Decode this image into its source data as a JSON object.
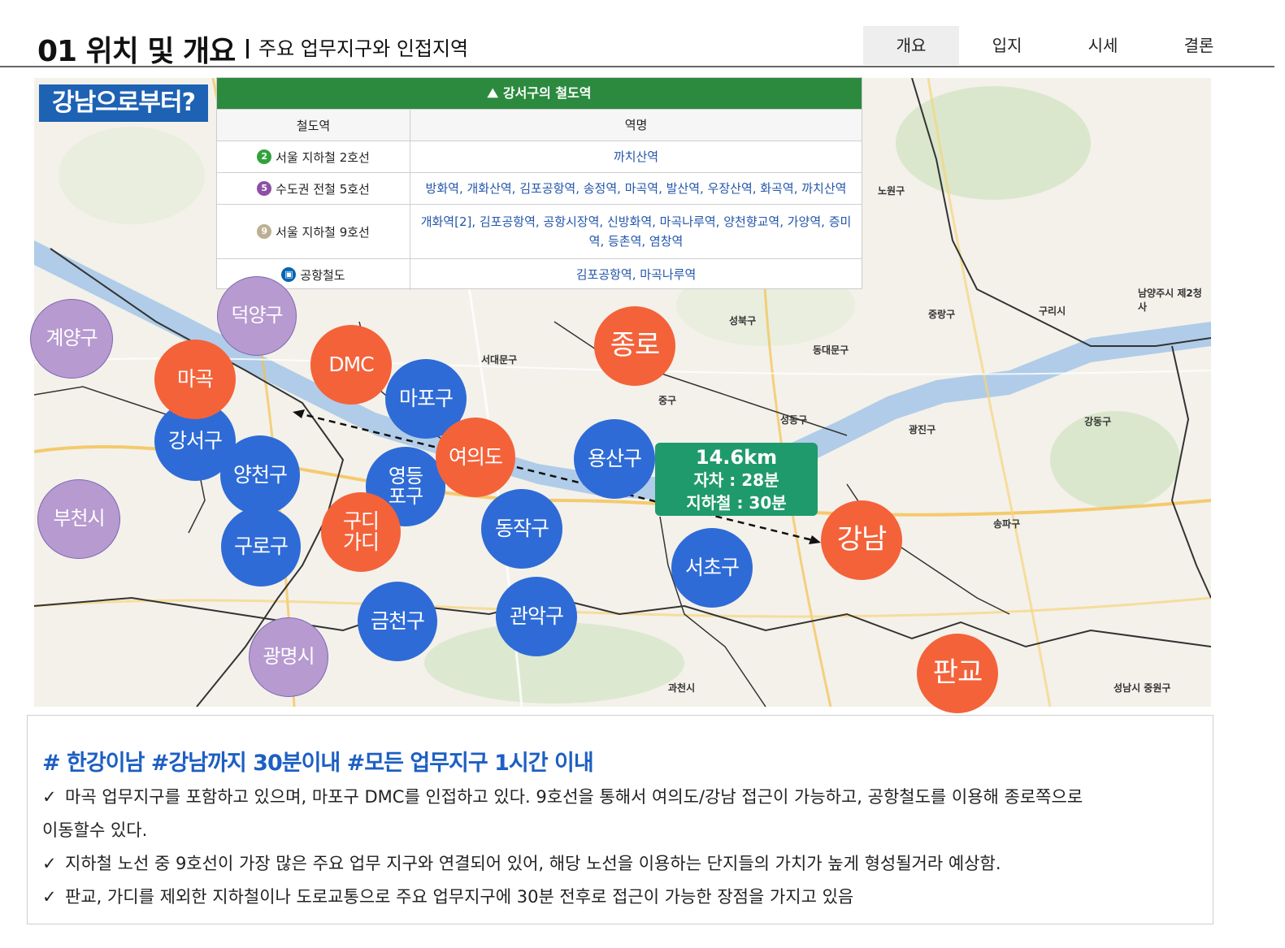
{
  "header": {
    "title": "01 위치 및 개요",
    "subtitle": "주요 업무지구와 인접지역",
    "tabs": [
      "개요",
      "입지",
      "시세",
      "결론"
    ],
    "active_tab": "개요"
  },
  "badge": "강남으로부터?",
  "table": {
    "title": "강서구의 철도역",
    "col_line": "철도역",
    "col_station": "역명",
    "rows": [
      {
        "num": "2",
        "color": "#33a23d",
        "line": "서울 지하철 2호선",
        "stations": "까치산역"
      },
      {
        "num": "5",
        "color": "#8b50a4",
        "line": "수도권 전철 5호선",
        "stations": "방화역, 개화산역, 김포공항역, 송정역, 마곡역, 발산역, 우장산역, 화곡역, 까치산역"
      },
      {
        "num": "9",
        "color": "#bdb092",
        "line": "서울 지하철 9호선",
        "stations": "개화역[2], 김포공항역, 공항시장역, 신방화역, 마곡나루역, 양천향교역, 가양역, 증미역, 등촌역, 염창역"
      },
      {
        "num": "",
        "color": "#0065b3",
        "line": "공항철도",
        "stations": "김포공항역, 마곡나루역"
      }
    ]
  },
  "map": {
    "districts_orange": [
      "마곡",
      "DMC",
      "종로",
      "여의도",
      "구디\n가디",
      "강남",
      "판교"
    ],
    "districts_blue": [
      "강서구",
      "마포구",
      "양천구",
      "영등\n포구",
      "용산구",
      "구로구",
      "동작구",
      "서초구",
      "금천구",
      "관악구"
    ],
    "districts_purple": [
      "덕양구",
      "계양구",
      "부천시",
      "광명시"
    ],
    "labels": [
      "서대문구",
      "성북구",
      "중랑구",
      "노원구",
      "구리시",
      "동대문구",
      "성동구",
      "광진구",
      "강동구",
      "중구",
      "송파구",
      "과천시",
      "성남시 중원구",
      "남양주시 제2청사"
    ],
    "distance": {
      "km": "14.6km",
      "car": "자차 : 28분",
      "subway": "지하철 : 30분"
    }
  },
  "notes": {
    "tags": "# 한강이남 #강남까지 30분이내 #모든 업무지구 1시간 이내",
    "bullets": [
      "마곡 업무지구를 포함하고 있으며, 마포구 DMC를 인접하고 있다. 9호선을 통해서 여의도/강남 접근이 가능하고, 공항철도를 이용해 종로쪽으로",
      "이동할수 있다.",
      "지하철 노선 중 9호선이 가장 많은 주요 업무 지구와 연결되어 있어, 해당 노선을 이용하는 단지들의 가치가 높게 형성될거라 예상함.",
      "판교, 가디를 제외한 지하철이나 도로교통으로 주요 업무지구에 30분 전후로 접근이 가능한 장점을 가지고 있음"
    ],
    "check": "✓"
  }
}
